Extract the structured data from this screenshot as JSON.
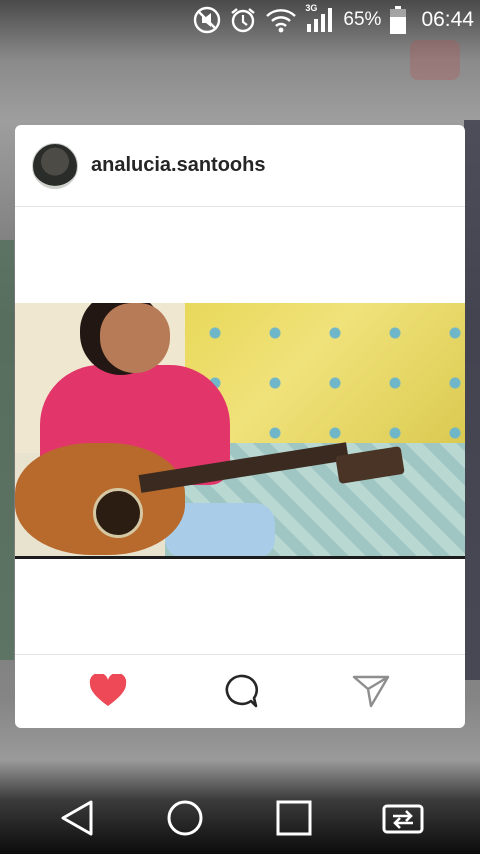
{
  "status_bar": {
    "icons": [
      "do-not-disturb-icon",
      "alarm-icon",
      "wifi-icon",
      "cellular-3g-icon",
      "battery-icon"
    ],
    "network_type": "3G",
    "battery_percent": "65%",
    "time": "06:44"
  },
  "post": {
    "username": "analucia.santoohs",
    "liked": true,
    "like_color": "#ed4956"
  },
  "actions": [
    "heart-icon",
    "comment-icon",
    "share-icon"
  ],
  "nav_bar": [
    "back-icon",
    "home-icon",
    "recent-apps-icon",
    "switch-apps-icon"
  ]
}
